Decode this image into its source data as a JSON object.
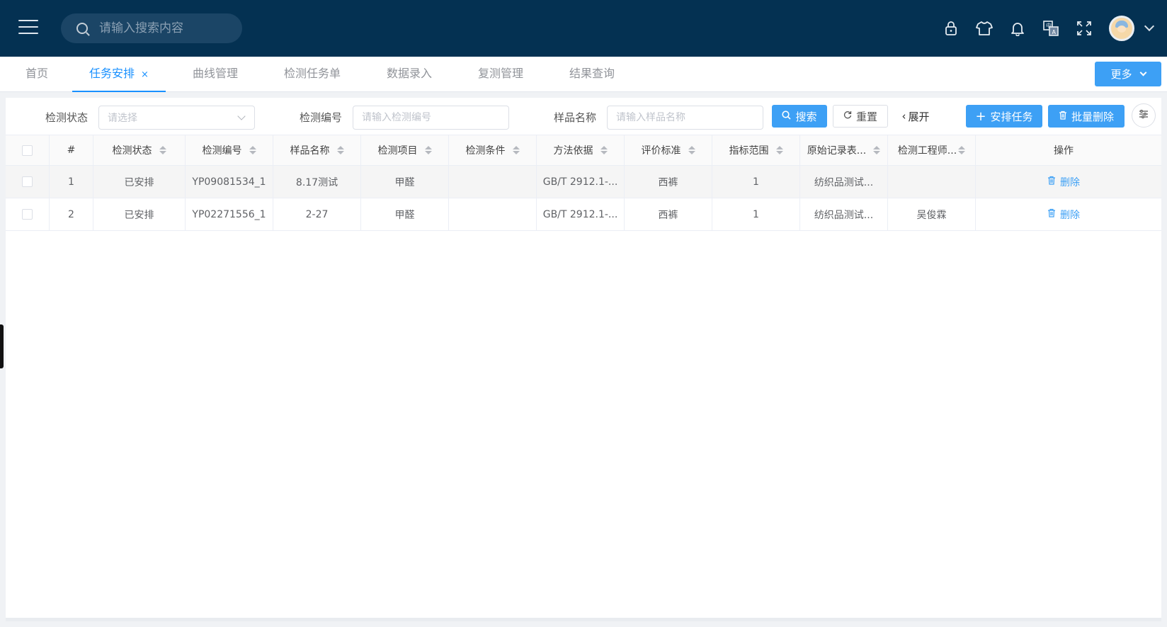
{
  "header": {
    "search_placeholder": "请输入搜索内容",
    "icons": [
      "lock-icon",
      "shirt-icon",
      "bell-icon",
      "translate-icon",
      "fullscreen-icon"
    ]
  },
  "tabs": [
    {
      "label": "首页"
    },
    {
      "label": "任务安排",
      "active": true,
      "close": "×"
    },
    {
      "label": "曲线管理"
    },
    {
      "label": "检测任务单"
    },
    {
      "label": "数据录入"
    },
    {
      "label": "复测管理"
    },
    {
      "label": "结果查询"
    }
  ],
  "more_label": "更多",
  "filters": {
    "status_label": "检测状态",
    "status_placeholder": "请选择",
    "code_label": "检测编号",
    "code_placeholder": "请输入检测编号",
    "sample_label": "样品名称",
    "sample_placeholder": "请输入样品名称",
    "search_btn": "搜索",
    "reset_btn": "重置",
    "expand_btn": "展开",
    "arrange_btn": "安排任务",
    "batch_delete_btn": "批量删除"
  },
  "table": {
    "columns": [
      "#",
      "检测状态",
      "检测编号",
      "样品名称",
      "检测项目",
      "检测条件",
      "方法依据",
      "评价标准",
      "指标范围",
      "原始记录表...",
      "检测工程师...",
      "操作"
    ],
    "rows": [
      {
        "index": "1",
        "status": "已安排",
        "code": "YP09081534_1",
        "sample": "8.17测试",
        "item": "甲醛",
        "condition": "",
        "method": "GB/T 2912.1-...",
        "standard": "西裤",
        "range": "1",
        "record": "纺织品测试...",
        "engineer": "",
        "action": "删除"
      },
      {
        "index": "2",
        "status": "已安排",
        "code": "YP02271556_1",
        "sample": "2-27",
        "item": "甲醛",
        "condition": "",
        "method": "GB/T 2912.1-...",
        "standard": "西裤",
        "range": "1",
        "record": "纺织品测试...",
        "engineer": "吴俊霖",
        "action": "删除"
      }
    ]
  },
  "colors": {
    "header_bg": "#043152",
    "primary": "#3da0f5"
  }
}
